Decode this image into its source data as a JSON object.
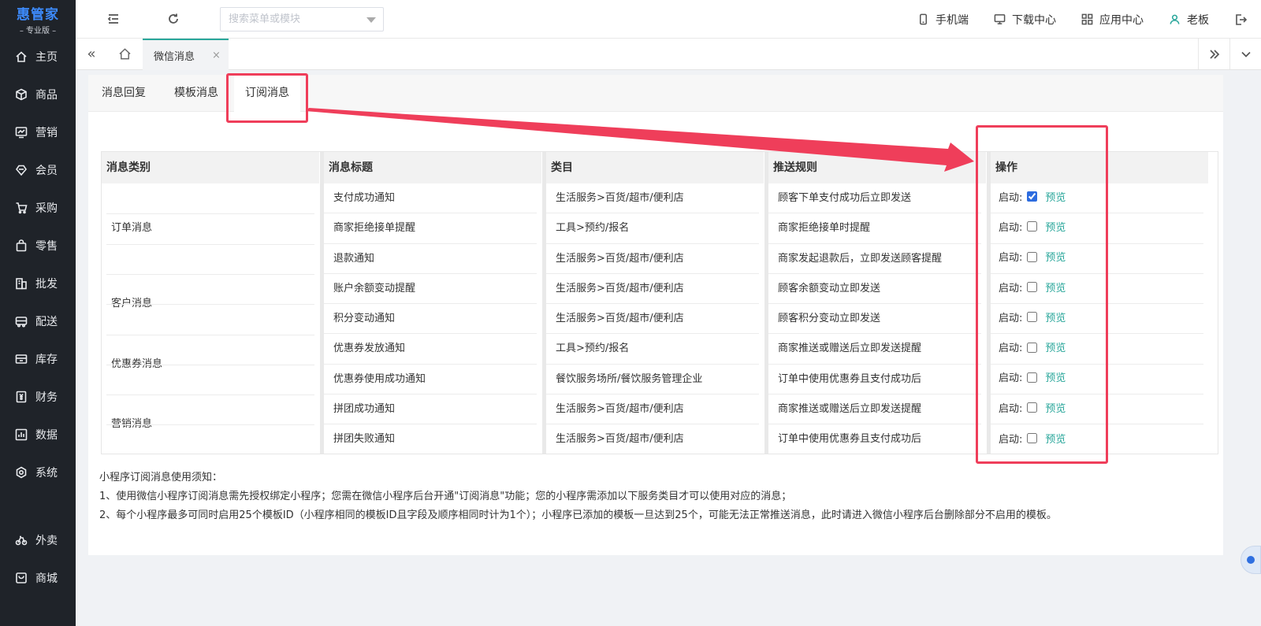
{
  "logo": {
    "main": "惠管家",
    "sub": "– 专业版 –"
  },
  "sidebar": {
    "items": [
      {
        "label": "主页",
        "icon": "home-icon"
      },
      {
        "label": "商品",
        "icon": "cube-icon"
      },
      {
        "label": "营销",
        "icon": "chart-monitor-icon"
      },
      {
        "label": "会员",
        "icon": "diamond-icon"
      },
      {
        "label": "采购",
        "icon": "cart-icon"
      },
      {
        "label": "零售",
        "icon": "bag-icon"
      },
      {
        "label": "批发",
        "icon": "building-icon"
      },
      {
        "label": "配送",
        "icon": "truck-icon"
      },
      {
        "label": "库存",
        "icon": "box-icon"
      },
      {
        "label": "财务",
        "icon": "money-icon"
      },
      {
        "label": "数据",
        "icon": "bar-chart-icon"
      },
      {
        "label": "系统",
        "icon": "settings-icon"
      }
    ],
    "extra_items": [
      {
        "label": "外卖",
        "icon": "bike-icon"
      },
      {
        "label": "商城",
        "icon": "store-icon"
      }
    ]
  },
  "header": {
    "search_placeholder": "搜索菜单或模块",
    "links": {
      "mobile": "手机端",
      "download": "下载中心",
      "apps": "应用中心",
      "user": "老板"
    }
  },
  "tabbar": {
    "active_tab": "微信消息",
    "close": "×"
  },
  "subtabs": [
    "消息回复",
    "模板消息",
    "订阅消息"
  ],
  "active_subtab": "订阅消息",
  "table": {
    "headers": [
      "消息类别",
      "消息标题",
      "类目",
      "推送规则",
      "操作"
    ],
    "categories": [
      {
        "label": "订单消息",
        "rows": 3
      },
      {
        "label": "客户消息",
        "rows": 2
      },
      {
        "label": "优惠券消息",
        "rows": 2
      },
      {
        "label": "营销消息",
        "rows": 2
      }
    ],
    "rows": [
      {
        "title": "支付成功通知",
        "category": "生活服务>百货/超市/便利店",
        "rule": "顾客下单支付成功后立即发送",
        "enabled": true
      },
      {
        "title": "商家拒绝接单提醒",
        "category": "工具>预约/报名",
        "rule": "商家拒绝接单时提醒",
        "enabled": false
      },
      {
        "title": "退款通知",
        "category": "生活服务>百货/超市/便利店",
        "rule": "商家发起退款后，立即发送顾客提醒",
        "enabled": false
      },
      {
        "title": "账户余额变动提醒",
        "category": "生活服务>百货/超市/便利店",
        "rule": "顾客余额变动立即发送",
        "enabled": false
      },
      {
        "title": "积分变动通知",
        "category": "生活服务>百货/超市/便利店",
        "rule": "顾客积分变动立即发送",
        "enabled": false
      },
      {
        "title": "优惠券发放通知",
        "category": "工具>预约/报名",
        "rule": "商家推送或赠送后立即发送提醒",
        "enabled": false
      },
      {
        "title": "优惠券使用成功通知",
        "category": "餐饮服务场所/餐饮服务管理企业",
        "rule": "订单中使用优惠券且支付成功后",
        "enabled": false
      },
      {
        "title": "拼团成功通知",
        "category": "生活服务>百货/超市/便利店",
        "rule": "商家推送或赠送后立即发送提醒",
        "enabled": false
      },
      {
        "title": "拼团失败通知",
        "category": "生活服务>百货/超市/便利店",
        "rule": "订单中使用优惠券且支付成功后",
        "enabled": false
      }
    ],
    "op_enable_label": "启动:",
    "op_preview_label": "预览"
  },
  "notes": {
    "title": "小程序订阅消息使用须知：",
    "line1": "1、使用微信小程序订阅消息需先授权绑定小程序；您需在微信小程序后台开通\"订阅消息\"功能；您的小程序需添加以下服务类目才可以使用对应的消息；",
    "line2": "2、每个小程序最多可同时启用25个模板ID（小程序相同的模板ID且字段及顺序相同时计为1个）；小程序已添加的模板一旦达到25个，可能无法正常推送消息，此时请进入微信小程序后台删除部分不启用的模板。"
  },
  "colors": {
    "accent": "#2aa79b",
    "annotation": "#ef3e5a",
    "sidebar_bg": "#1f2329",
    "logo": "#3d8bfd"
  }
}
